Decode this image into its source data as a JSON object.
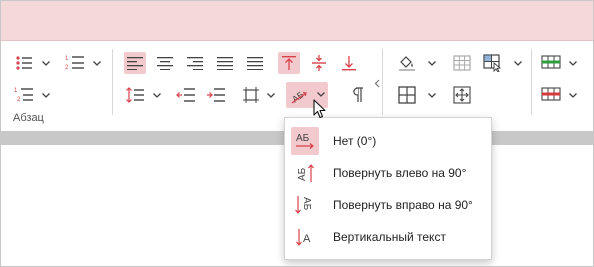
{
  "ribbon": {
    "group_label": "Абзац"
  },
  "paragraph_tools": [
    {
      "icon": "bulleted-list-icon"
    },
    {
      "icon": "numbered-list-icon"
    },
    {
      "icon": "multilevel-list-icon"
    },
    {
      "icon": "line-spacing-icon"
    },
    {
      "icon": "decrease-indent-icon"
    },
    {
      "icon": "increase-indent-icon"
    },
    {
      "icon": "align-left-icon",
      "active": true
    },
    {
      "icon": "align-center-icon"
    },
    {
      "icon": "align-right-icon"
    },
    {
      "icon": "justify-icon"
    },
    {
      "icon": "distributed-icon"
    },
    {
      "icon": "align-top-icon",
      "active": true
    },
    {
      "icon": "align-middle-icon"
    },
    {
      "icon": "align-bottom-icon"
    },
    {
      "icon": "cell-margins-icon"
    },
    {
      "icon": "text-direction-icon",
      "active": true
    },
    {
      "icon": "pilcrow-icon"
    },
    {
      "icon": "shading-icon"
    },
    {
      "icon": "table-grid-icon"
    },
    {
      "icon": "select-cell-icon"
    },
    {
      "icon": "borders-icon"
    },
    {
      "icon": "fit-icon"
    },
    {
      "icon": "border-color-green-icon"
    },
    {
      "icon": "border-color-red-icon"
    }
  ],
  "colors": {
    "accent": "#d9424c",
    "active_bg": "#f2c9cc",
    "title_strip": "#f4d8da",
    "green": "#2e9e3e",
    "red": "#d63a3a"
  },
  "text_direction_menu": {
    "items": [
      {
        "label": "Нет (0°)",
        "icon": "text-horizontal-icon",
        "selected": true
      },
      {
        "label": "Повернуть влево на 90°",
        "icon": "text-rotate-left-icon",
        "selected": false
      },
      {
        "label": "Повернуть вправо на 90°",
        "icon": "text-rotate-right-icon",
        "selected": false
      },
      {
        "label": "Вертикальный текст",
        "icon": "text-vertical-icon",
        "selected": false
      }
    ],
    "icon_glyphs": {
      "horizontal": "АБ",
      "vertical": "А"
    }
  }
}
